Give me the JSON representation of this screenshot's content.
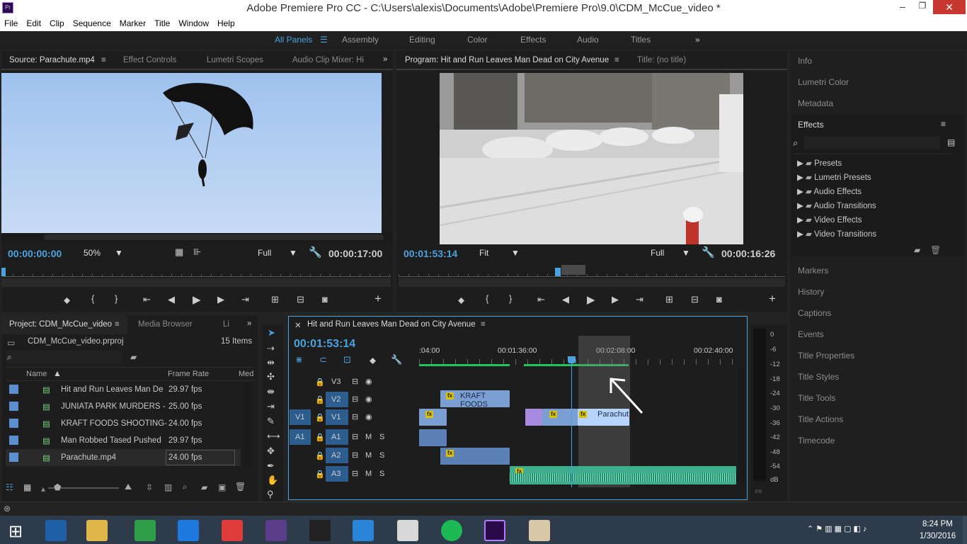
{
  "window": {
    "title": "Adobe Premiere Pro CC - C:\\Users\\alexis\\Documents\\Adobe\\Premiere Pro\\9.0\\CDM_McCue_video *"
  },
  "menu": [
    "File",
    "Edit",
    "Clip",
    "Sequence",
    "Marker",
    "Title",
    "Window",
    "Help"
  ],
  "workspaces": {
    "all": "All Panels",
    "items": [
      "Assembly",
      "Editing",
      "Color",
      "Effects",
      "Audio",
      "Titles"
    ]
  },
  "source": {
    "tabs": [
      "Source: Parachute.mp4",
      "Effect Controls",
      "Lumetri Scopes",
      "Audio Clip Mixer: Hi"
    ],
    "timecode": "00:00:00:00",
    "zoom": "50%",
    "quality": "Full",
    "duration": "00:00:17:00"
  },
  "program": {
    "tabs": [
      "Program: Hit and Run Leaves Man Dead on City Avenue",
      "Title: (no title)"
    ],
    "timecode": "00:01:53:14",
    "zoom": "Fit",
    "quality": "Full",
    "duration": "00:00:16:26"
  },
  "project": {
    "tabs": [
      "Project: CDM_McCue_video",
      "Media Browser",
      "Li"
    ],
    "file": "CDM_McCue_video.prproj",
    "count": "15 Items",
    "headers": {
      "name": "Name",
      "rate": "Frame Rate",
      "media": "Med"
    },
    "rows": [
      {
        "name": "Hit and Run Leaves Man De",
        "rate": "29.97 fps"
      },
      {
        "name": "JUNIATA PARK MURDERS -",
        "rate": "25.00 fps"
      },
      {
        "name": "KRAFT FOODS SHOOTING-",
        "rate": "24.00 fps"
      },
      {
        "name": "Man Robbed Tased Pushed",
        "rate": "29.97 fps"
      },
      {
        "name": "Parachute.mp4",
        "rate": "24.00 fps"
      }
    ]
  },
  "timeline": {
    "title": "Hit and Run Leaves Man Dead on City Avenue",
    "timecode": "00:01:53:14",
    "ruler": [
      ":04:00",
      "00:01:36:00",
      "00:02:08:00",
      "00:02:40:00"
    ],
    "tracks": {
      "v3": "V3",
      "v2": "V2",
      "v1": "V1",
      "v1src": "V1",
      "a1": "A1",
      "a1src": "A1",
      "a2": "A2",
      "a3": "A3"
    },
    "clips": {
      "kraft": "KRAFT FOODS",
      "parachute": "Parachut"
    }
  },
  "meter": {
    "labels": [
      "0",
      "-6",
      "-12",
      "-18",
      "-24",
      "-30",
      "-36",
      "-42",
      "-48",
      "-54",
      "dB"
    ]
  },
  "right_panel": {
    "top": [
      "Info",
      "Lumetri Color",
      "Metadata"
    ],
    "effects_title": "Effects",
    "effects": [
      "Presets",
      "Lumetri Presets",
      "Audio Effects",
      "Audio Transitions",
      "Video Effects",
      "Video Transitions"
    ],
    "bottom": [
      "Markers",
      "History",
      "Captions",
      "Events",
      "Title Properties",
      "Title Styles",
      "Title Tools",
      "Title Actions",
      "Timecode"
    ]
  },
  "clock": {
    "time": "8:24 PM",
    "date": "1/30/2016"
  }
}
